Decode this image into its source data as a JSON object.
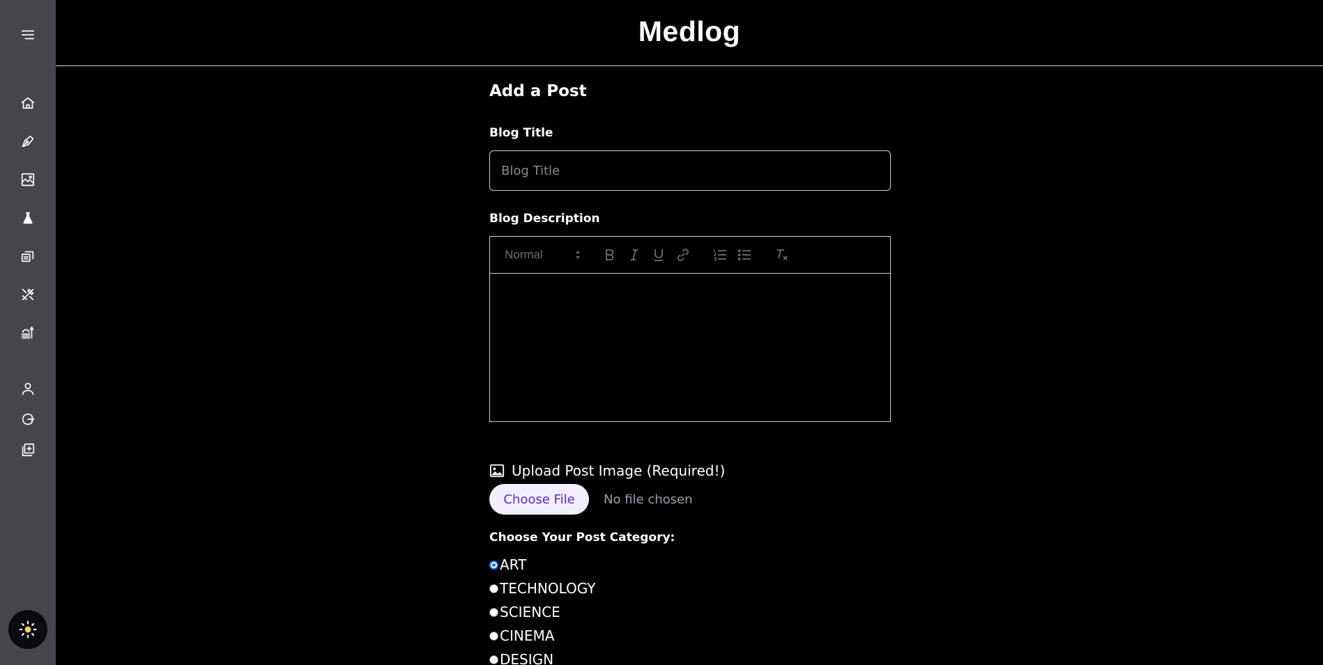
{
  "app": {
    "brand": "Medlog"
  },
  "sidebar": {
    "items": [
      {
        "icon": "menu-icon"
      },
      {
        "icon": "home-icon"
      },
      {
        "icon": "pen-tool-icon"
      },
      {
        "icon": "art-image-icon"
      },
      {
        "icon": "flask-icon"
      },
      {
        "icon": "cinema-tickets-icon"
      },
      {
        "icon": "design-tools-icon"
      },
      {
        "icon": "food-icon"
      },
      {
        "icon": "user-icon"
      },
      {
        "icon": "logout-icon"
      },
      {
        "icon": "add-post-icon"
      }
    ],
    "theme_toggle_icon": "sun-icon"
  },
  "form": {
    "heading": "Add a Post",
    "title_label": "Blog Title",
    "title_placeholder": "Blog Title",
    "title_value": "",
    "description_label": "Blog Description",
    "toolbar": {
      "size_value": "Normal",
      "buttons": [
        "bold",
        "italic",
        "underline",
        "link",
        "ordered-list",
        "bullet-list",
        "clear-format"
      ]
    },
    "upload_label": "Upload Post Image (Required!)",
    "choose_file_label": "Choose File",
    "no_file_text": "No file chosen",
    "category_label": "Choose Your Post Category:",
    "categories": [
      {
        "label": "ART",
        "checked": true
      },
      {
        "label": "TECHNOLOGY",
        "checked": false
      },
      {
        "label": "SCIENCE",
        "checked": false
      },
      {
        "label": "CINEMA",
        "checked": false
      },
      {
        "label": "DESIGN",
        "checked": false
      }
    ]
  },
  "colors": {
    "sidebar_bg": "#45464b",
    "page_bg": "#000000",
    "choose_btn_bg": "#f3eeff",
    "choose_btn_text": "#5a2bbd",
    "radio_checked": "#1a73e8"
  }
}
